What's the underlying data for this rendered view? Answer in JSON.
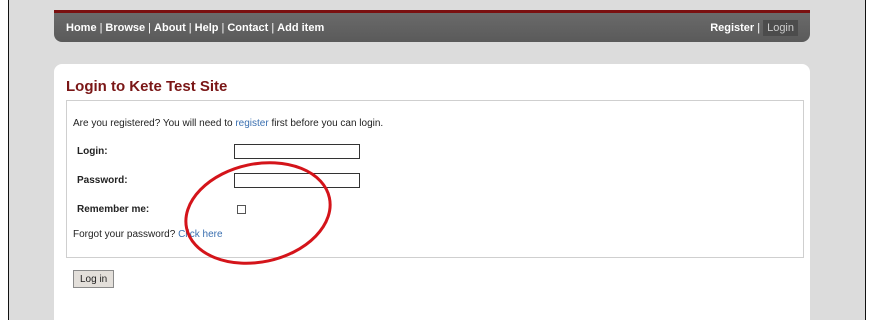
{
  "nav": {
    "left_links": [
      "Home",
      "Browse",
      "About",
      "Help",
      "Contact",
      "Add item"
    ],
    "register": "Register",
    "login": "Login"
  },
  "page": {
    "title": "Login to Kete Test Site",
    "intro_prefix": "Are you registered? You will need to ",
    "intro_link": "register",
    "intro_suffix": " first before you can login."
  },
  "form": {
    "login_label": "Login:",
    "login_value": "",
    "password_label": "Password:",
    "password_value": "",
    "remember_label": "Remember me:",
    "remember_checked": false,
    "forgot_prefix": "Forgot your password? ",
    "forgot_link": "Click here",
    "submit_label": "Log in"
  },
  "colors": {
    "nav_bg": "#5f5f5f",
    "nav_border": "#7a1010",
    "title": "#7a1616",
    "link": "#3a6fb0",
    "annotation": "#d4141a"
  }
}
